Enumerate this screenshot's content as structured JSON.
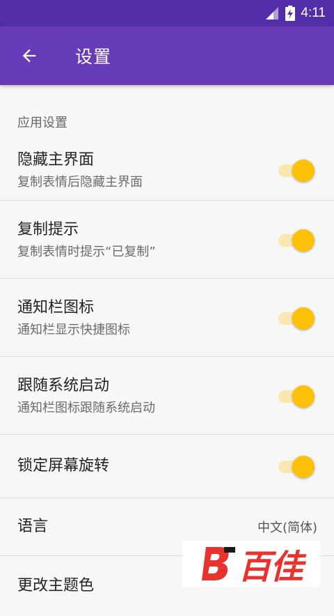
{
  "status_bar": {
    "time": "4:11"
  },
  "app_bar": {
    "title": "设置"
  },
  "section_label": "应用设置",
  "settings": [
    {
      "title": "隐藏主界面",
      "subtitle": "复制表情后隐藏主界面",
      "enabled": true
    },
    {
      "title": "复制提示",
      "subtitle": "复制表情时提示“已复制”",
      "enabled": true
    },
    {
      "title": "通知栏图标",
      "subtitle": "通知栏显示快捷图标",
      "enabled": true
    },
    {
      "title": "跟随系统启动",
      "subtitle": "通知栏图标跟随系统启动",
      "enabled": true
    },
    {
      "title": "锁定屏幕旋转",
      "enabled": true
    }
  ],
  "language": {
    "title": "语言",
    "value": "中文(简体)"
  },
  "theme": {
    "title": "更改主题色"
  },
  "watermark": {
    "text": "百佳"
  },
  "colors": {
    "status_bar": "#512da8",
    "app_bar": "#673ab7",
    "toggle_thumb": "#ffc107",
    "toggle_track": "#fbe8b0"
  }
}
